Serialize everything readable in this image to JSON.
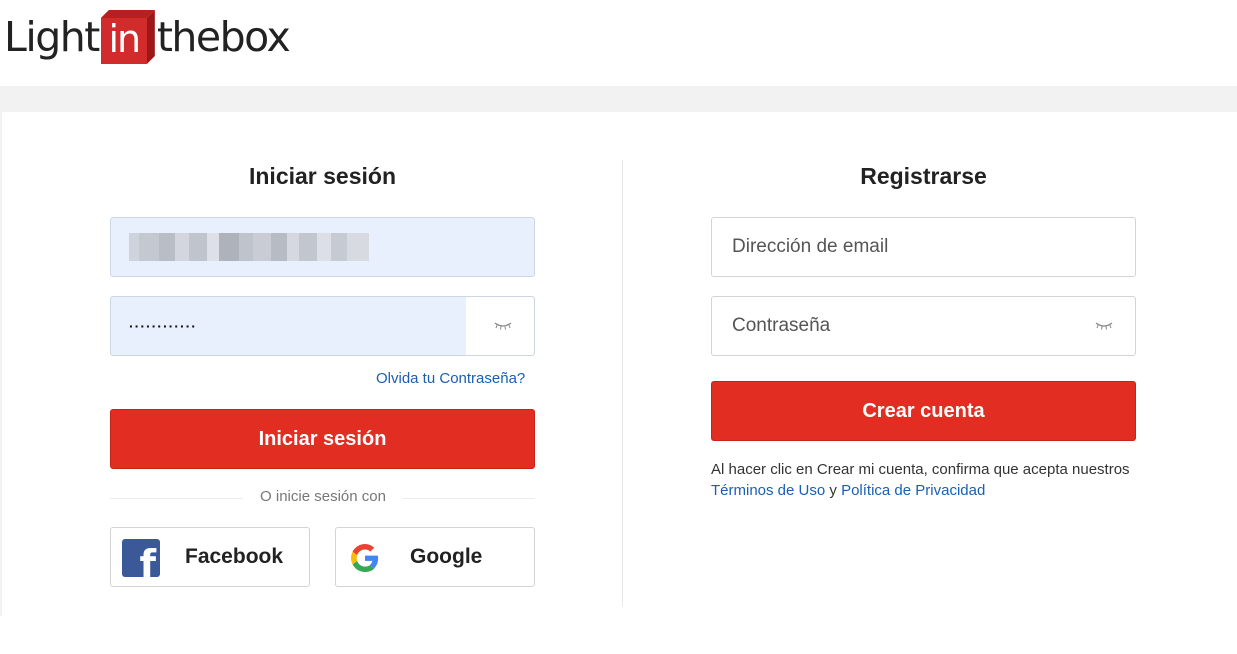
{
  "brand": {
    "logo_left": "Light",
    "logo_box": "in",
    "logo_right": "thebox"
  },
  "login": {
    "title": "Iniciar sesión",
    "password_mask": "············",
    "forgot_link": "Olvida tu Contraseña?",
    "submit_label": "Iniciar sesión",
    "divider_text": "O inicie sesión con",
    "facebook_label": "Facebook",
    "google_label": "Google"
  },
  "register": {
    "title": "Registrarse",
    "email_placeholder": "Dirección de email",
    "password_placeholder": "Contraseña",
    "submit_label": "Crear cuenta",
    "terms_prefix": "Al hacer clic en Crear mi cuenta, confirma que acepta nuestros ",
    "terms_link": "Términos de Uso",
    "terms_and": " y ",
    "privacy_link": "Política de Privacidad"
  },
  "icons": {
    "eye": "eye-closed-icon",
    "facebook": "facebook-icon",
    "google": "google-icon"
  },
  "colors": {
    "brand_red": "#e12d22",
    "link_blue": "#1a5fb4",
    "autofill_bg": "#e8f0fe",
    "facebook_blue": "#3b5998"
  }
}
